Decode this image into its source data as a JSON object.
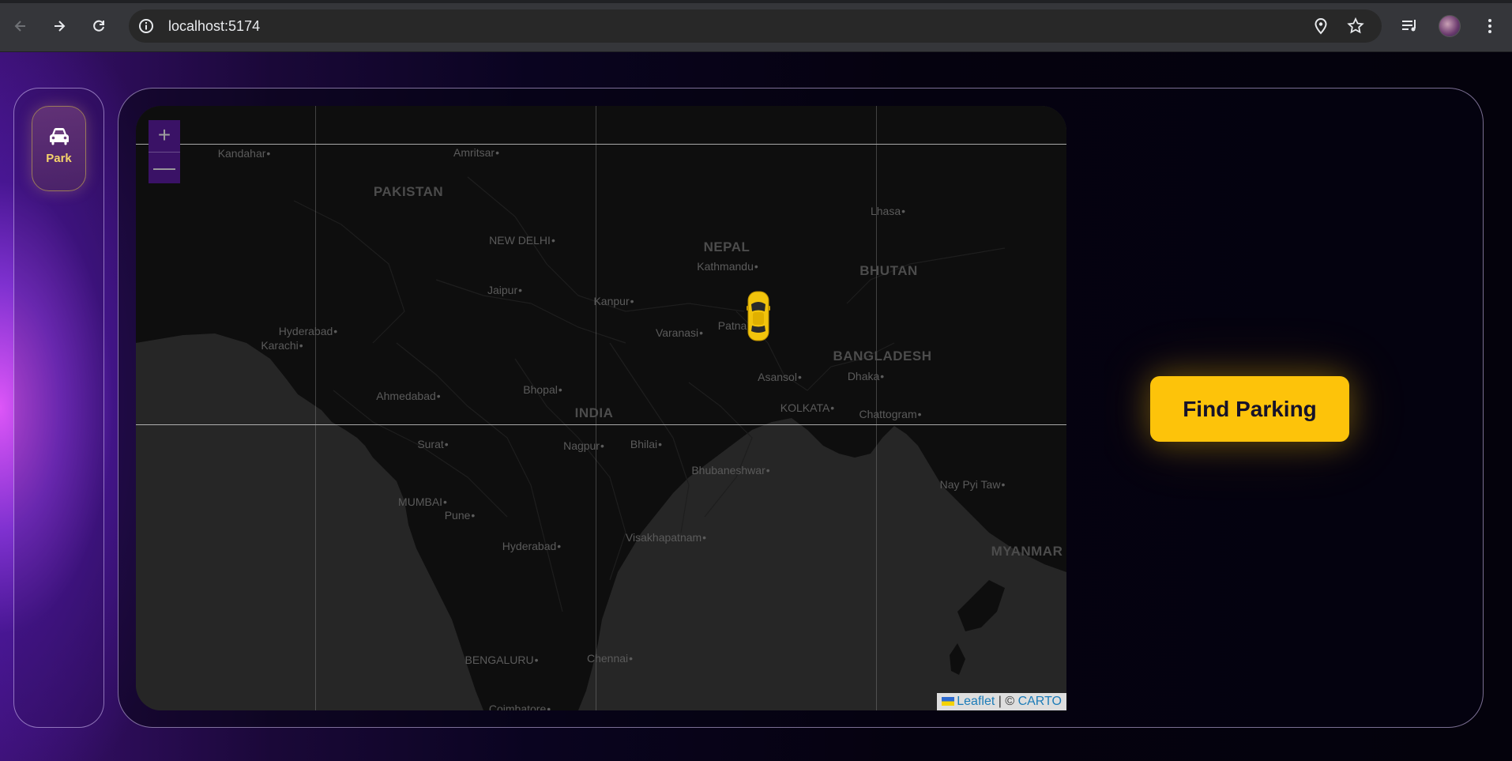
{
  "browser": {
    "url": "localhost:5174",
    "icons": {
      "back": "back-arrow-icon",
      "forward": "forward-arrow-icon",
      "reload": "reload-icon",
      "site_info": "info-icon",
      "location": "location-pin-icon",
      "bookmark": "star-icon",
      "media": "media-list-icon",
      "profile": "avatar",
      "menu": "kebab-menu-icon"
    }
  },
  "sidebar": {
    "park_label": "Park",
    "park_icon": "car-icon"
  },
  "map": {
    "zoom_in": "+",
    "zoom_out": "—",
    "attribution": {
      "leaflet": "Leaflet",
      "separator": " | © ",
      "carto": "CARTO"
    },
    "countries": [
      {
        "name": "PAKISTAN"
      },
      {
        "name": "NEPAL"
      },
      {
        "name": "BHUTAN"
      },
      {
        "name": "BANGLADESH"
      },
      {
        "name": "INDIA"
      },
      {
        "name": "MYANMAR"
      }
    ],
    "cities": [
      {
        "name": "Kandahar"
      },
      {
        "name": "Amritsar"
      },
      {
        "name": "Lhasa"
      },
      {
        "name": "NEW DELHI"
      },
      {
        "name": "Kathmandu"
      },
      {
        "name": "Jaipur"
      },
      {
        "name": "Kanpur"
      },
      {
        "name": "Hyderabad"
      },
      {
        "name": "Karachi"
      },
      {
        "name": "Varanasi"
      },
      {
        "name": "Patna"
      },
      {
        "name": "Dhaka"
      },
      {
        "name": "Asansol"
      },
      {
        "name": "Ahmedabad"
      },
      {
        "name": "Bhopal"
      },
      {
        "name": "KOLKATA"
      },
      {
        "name": "Chattogram"
      },
      {
        "name": "Surat"
      },
      {
        "name": "Nagpur"
      },
      {
        "name": "Bhilai"
      },
      {
        "name": "Bhubaneshwar"
      },
      {
        "name": "Nay Pyi Taw"
      },
      {
        "name": "MUMBAI"
      },
      {
        "name": "Pune"
      },
      {
        "name": "Visakhapatnam"
      },
      {
        "name": "Hyderabad"
      },
      {
        "name": "BENGALURU"
      },
      {
        "name": "Chennai"
      },
      {
        "name": "Coimbatore"
      }
    ]
  },
  "actions": {
    "find_parking": "Find Parking"
  },
  "colors": {
    "accent": "#fdc30a",
    "zoom_bg": "#3a1266"
  }
}
